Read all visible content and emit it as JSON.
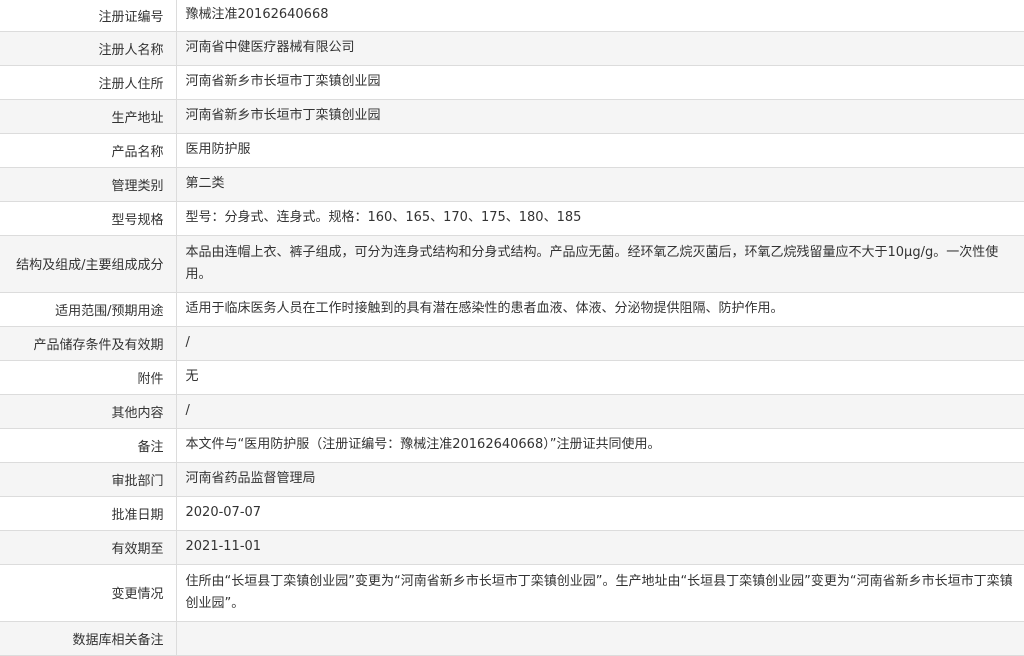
{
  "rows": [
    {
      "label": "注册证编号",
      "value": "豫械注准20162640668"
    },
    {
      "label": "注册人名称",
      "value": "河南省中健医疗器械有限公司"
    },
    {
      "label": "注册人住所",
      "value": "河南省新乡市长垣市丁栾镇创业园"
    },
    {
      "label": "生产地址",
      "value": "河南省新乡市长垣市丁栾镇创业园"
    },
    {
      "label": "产品名称",
      "value": "医用防护服"
    },
    {
      "label": "管理类别",
      "value": "第二类"
    },
    {
      "label": "型号规格",
      "value": "型号：分身式、连身式。规格：160、165、170、175、180、185"
    },
    {
      "label": "结构及组成/主要组成成分",
      "value": "本品由连帽上衣、裤子组成，可分为连身式结构和分身式结构。产品应无菌。经环氧乙烷灭菌后，环氧乙烷残留量应不大于10μg/g。一次性使用。"
    },
    {
      "label": "适用范围/预期用途",
      "value": "适用于临床医务人员在工作时接触到的具有潜在感染性的患者血液、体液、分泌物提供阻隔、防护作用。"
    },
    {
      "label": "产品储存条件及有效期",
      "value": "/"
    },
    {
      "label": "附件",
      "value": "无"
    },
    {
      "label": "其他内容",
      "value": "/"
    },
    {
      "label": "备注",
      "value": "本文件与“医用防护服（注册证编号：豫械注准20162640668）”注册证共同使用。"
    },
    {
      "label": "审批部门",
      "value": "河南省药品监督管理局"
    },
    {
      "label": "批准日期",
      "value": "2020-07-07"
    },
    {
      "label": "有效期至",
      "value": "2021-11-01"
    },
    {
      "label": "变更情况",
      "value": "住所由“长垣县丁栾镇创业园”变更为“河南省新乡市长垣市丁栾镇创业园”。生产地址由“长垣县丁栾镇创业园”变更为“河南省新乡市长垣市丁栾镇创业园”。"
    },
    {
      "label": "数据库相关备注",
      "value": ""
    }
  ]
}
